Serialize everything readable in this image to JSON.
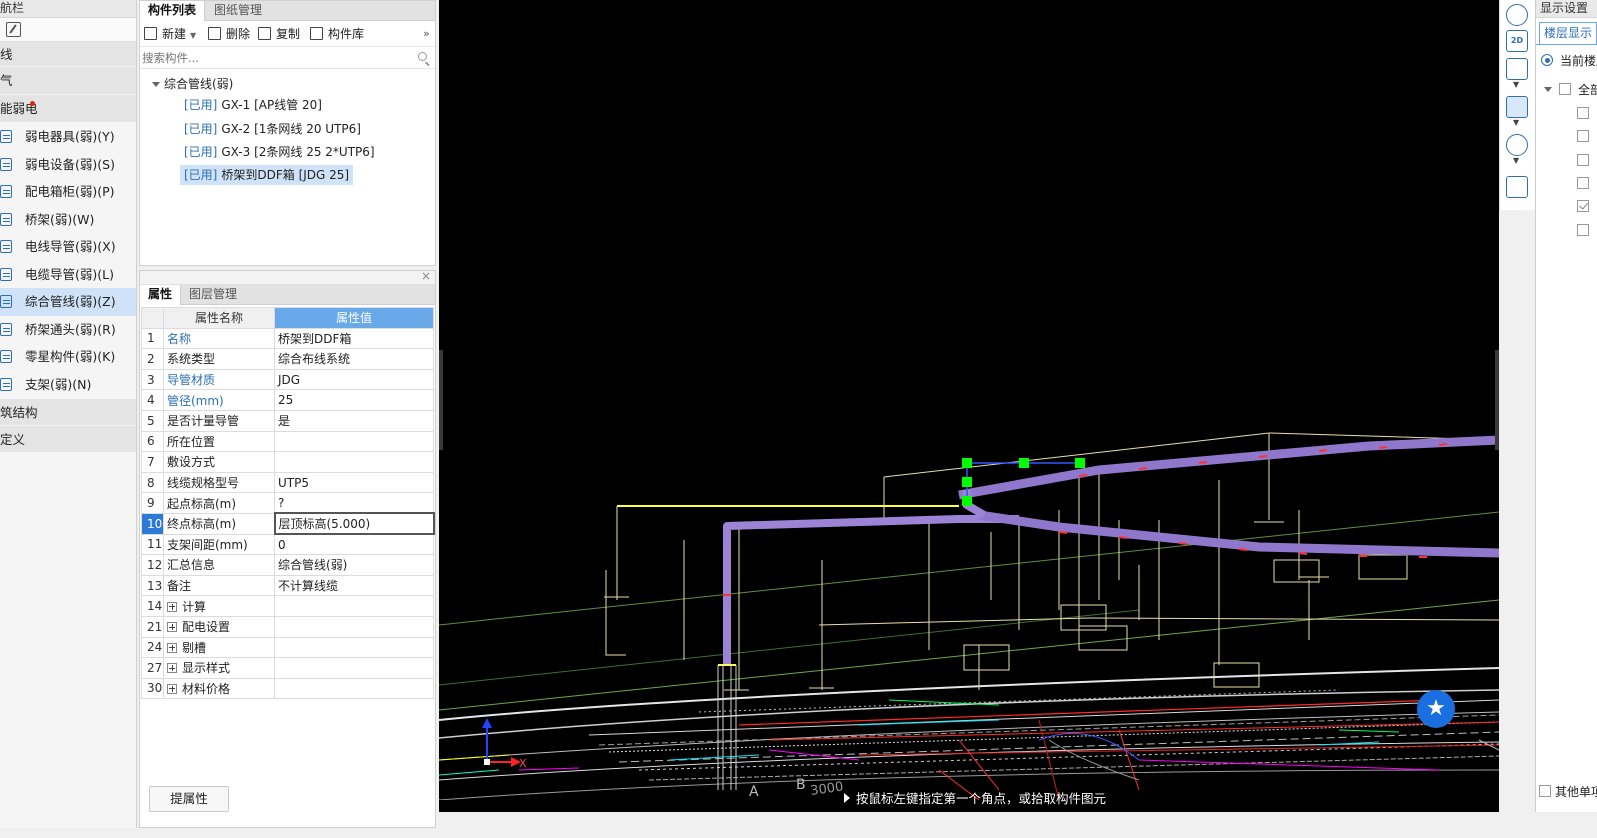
{
  "nav": {
    "title": "航栏",
    "categories_top": [
      "线",
      "气"
    ],
    "weak_cat": "能弱电",
    "items": [
      {
        "label": "弱电器具(弱)(Y)",
        "icon": "device-icon"
      },
      {
        "label": "弱电设备(弱)(S)",
        "icon": "equipment-icon"
      },
      {
        "label": "配电箱柜(弱)(P)",
        "icon": "panel-icon"
      },
      {
        "label": "桥架(弱)(W)",
        "icon": "tray-icon"
      },
      {
        "label": "电线导管(弱)(X)",
        "icon": "wire-conduit-icon"
      },
      {
        "label": "电缆导管(弱)(L)",
        "icon": "cable-conduit-icon"
      },
      {
        "label": "综合管线(弱)(Z)",
        "icon": "pipeline-icon"
      },
      {
        "label": "桥架通头(弱)(R)",
        "icon": "tray-joint-icon"
      },
      {
        "label": "零星构件(弱)(K)",
        "icon": "misc-icon"
      },
      {
        "label": "支架(弱)(N)",
        "icon": "support-icon"
      }
    ],
    "categories_bottom": [
      "筑结构",
      "定义"
    ]
  },
  "complist": {
    "tabs": [
      "构件列表",
      "图纸管理"
    ],
    "toolbar": {
      "new": "新建",
      "delete": "删除",
      "copy": "复制",
      "library": "构件库",
      "more": "»"
    },
    "search_placeholder": "搜索构件...",
    "root": "综合管线(弱)",
    "items": [
      {
        "tag": "[已用]",
        "label": "GX-1 [AP线管 20]"
      },
      {
        "tag": "[已用]",
        "label": "GX-2 [1条网线 20 UTP6]"
      },
      {
        "tag": "[已用]",
        "label": "GX-3 [2条网线 25 2*UTP6]"
      },
      {
        "tag": "[已用]",
        "label": "桥架到DDF箱 [JDG 25]"
      }
    ]
  },
  "props": {
    "close": "×",
    "tabs": [
      "属性",
      "图层管理"
    ],
    "head_name": "属性名称",
    "head_value": "属性值",
    "rows": [
      {
        "idx": "1",
        "name": "名称",
        "value": "桥架到DDF箱"
      },
      {
        "idx": "2",
        "name": "系统类型",
        "value": "综合布线系统"
      },
      {
        "idx": "3",
        "name": "导管材质",
        "value": "JDG"
      },
      {
        "idx": "4",
        "name": "管径(mm)",
        "value": "25"
      },
      {
        "idx": "5",
        "name": "是否计量导管",
        "value": "是"
      },
      {
        "idx": "6",
        "name": "所在位置",
        "value": ""
      },
      {
        "idx": "7",
        "name": "敷设方式",
        "value": ""
      },
      {
        "idx": "8",
        "name": "线缆规格型号",
        "value": "UTP5"
      },
      {
        "idx": "9",
        "name": "起点标高(m)",
        "value": "?"
      },
      {
        "idx": "10",
        "name": "终点标高(m)",
        "value": "层顶标高(5.000)"
      },
      {
        "idx": "11",
        "name": "支架间距(mm)",
        "value": "0"
      },
      {
        "idx": "12",
        "name": "汇总信息",
        "value": "综合管线(弱)"
      },
      {
        "idx": "13",
        "name": "备注",
        "value": "不计算线缆"
      },
      {
        "idx": "14",
        "name": "计算",
        "value": ""
      },
      {
        "idx": "21",
        "name": "配电设置",
        "value": ""
      },
      {
        "idx": "24",
        "name": "剔槽",
        "value": ""
      },
      {
        "idx": "27",
        "name": "显示样式",
        "value": ""
      },
      {
        "idx": "30",
        "name": "材料价格",
        "value": ""
      }
    ],
    "button": "提属性"
  },
  "viewport": {
    "hint": "按鼠标左键指定第一个角点，或拾取构件图元",
    "grid_labels": [
      "A",
      "B",
      "3000"
    ],
    "axis_label": "X",
    "fav_icon": "star-icon"
  },
  "vtools": {
    "label_2d": "2D"
  },
  "display": {
    "title": "显示设置",
    "tab": "楼层显示",
    "current": "当前楼层",
    "all": "全部",
    "other": "其他单项"
  },
  "colors": {
    "pipe": "#9b83d6",
    "accent": "#2d6fb5",
    "grip": "#00ff00",
    "header_blue": "#6aa9e9"
  }
}
